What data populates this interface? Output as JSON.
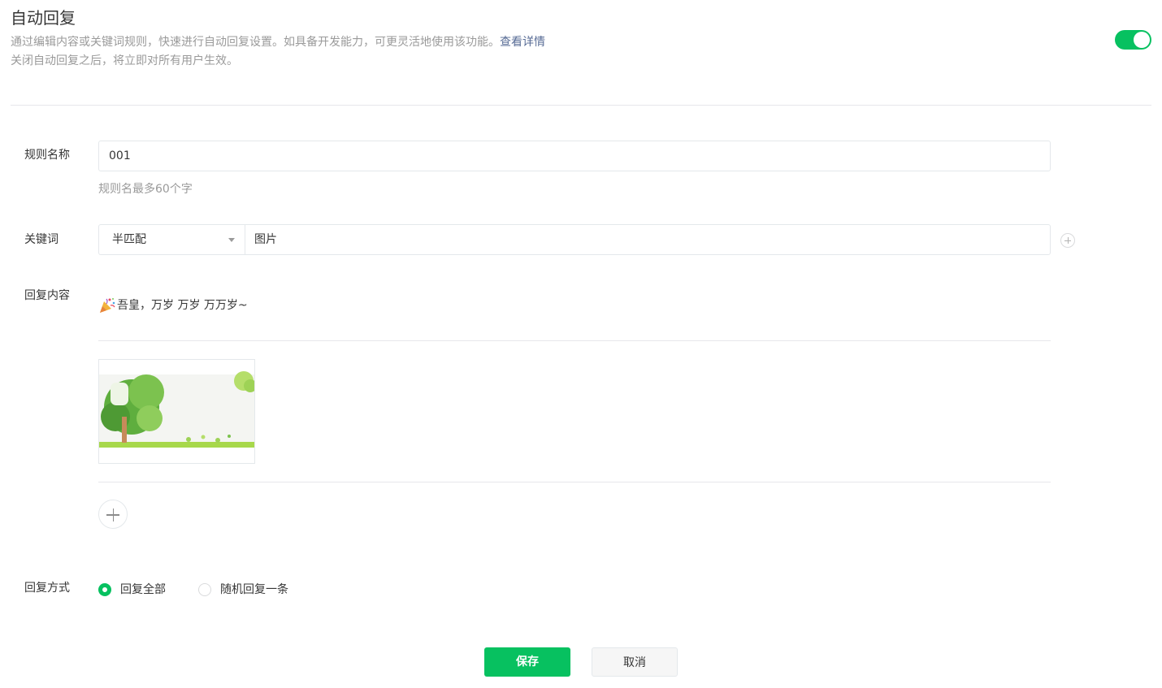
{
  "header": {
    "title": "自动回复",
    "description": "通过编辑内容或关键词规则，快速进行自动回复设置。如具备开发能力，可更灵活地使用该功能。",
    "details_link": "查看详情",
    "note": "关闭自动回复之后，将立即对所有用户生效。",
    "enabled": true
  },
  "form": {
    "rule_name": {
      "label": "规则名称",
      "value": "001",
      "hint": "规则名最多60个字"
    },
    "keyword": {
      "label": "关键词",
      "match_mode": "半匹配",
      "value": "图片"
    },
    "reply_content": {
      "label": "回复内容",
      "text": "吾皇，万岁 万岁 万万岁~",
      "emoji_icon": "party-popper-icon"
    },
    "reply_mode": {
      "label": "回复方式",
      "options": [
        {
          "label": "回复全部",
          "selected": true
        },
        {
          "label": "随机回复一条",
          "selected": false
        }
      ]
    }
  },
  "actions": {
    "save_label": "保存",
    "cancel_label": "取消"
  },
  "colors": {
    "accent": "#07c160",
    "link": "#576b95",
    "muted": "#9a9a9a",
    "border": "#e4e8eb"
  }
}
